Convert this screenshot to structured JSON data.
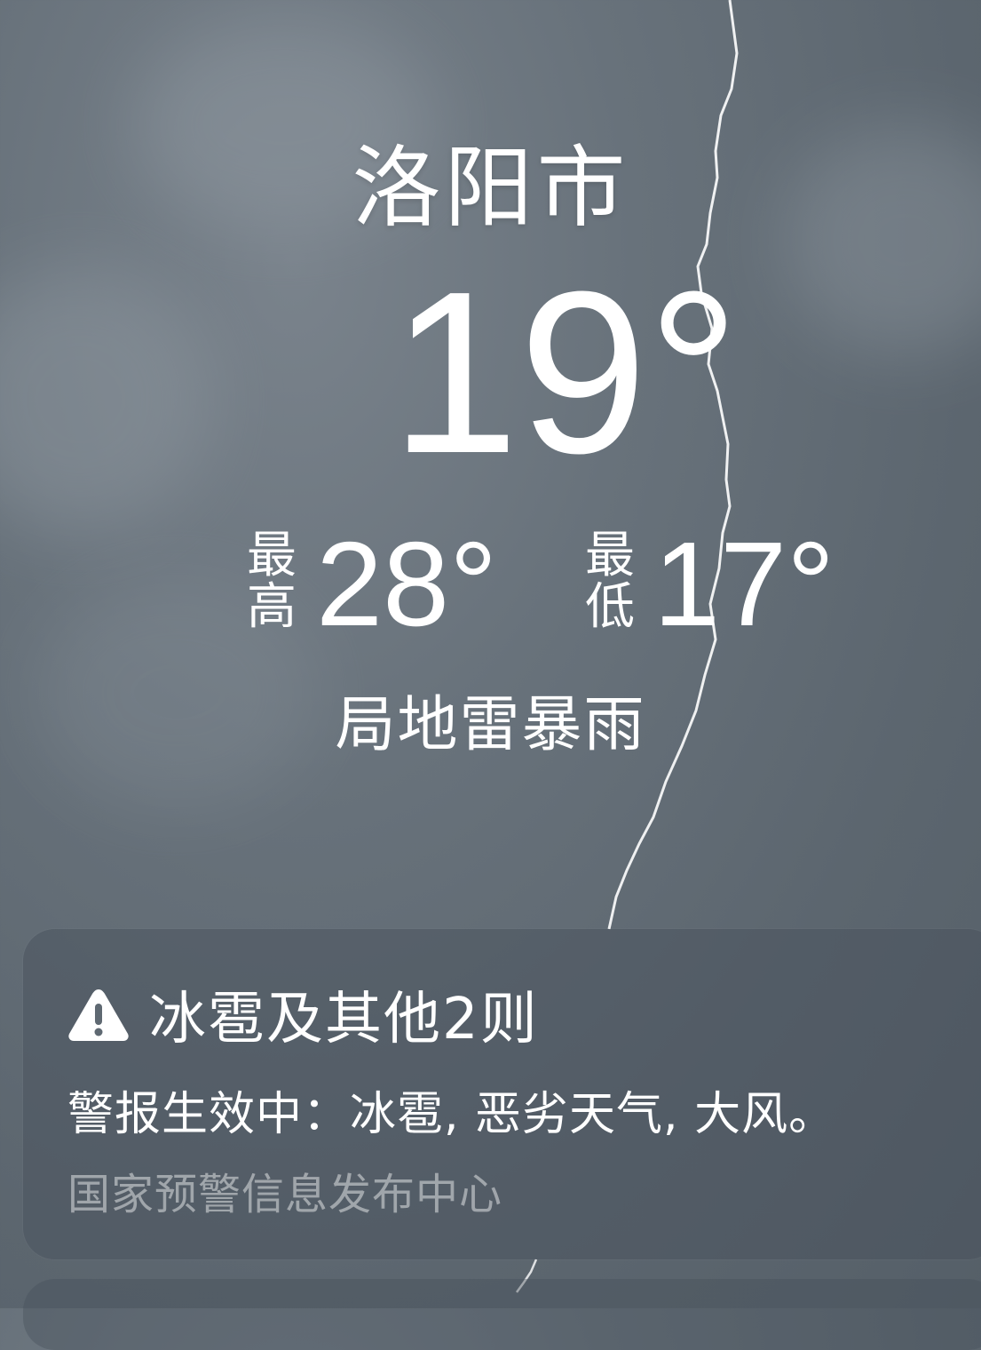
{
  "location": {
    "city": "洛阳市"
  },
  "current": {
    "temperature": "19°"
  },
  "range": {
    "high_label": "最高",
    "high_value": "28°",
    "low_label": "最低",
    "low_value": "17°"
  },
  "condition": "局地雷暴雨",
  "alert": {
    "icon": "warning-triangle-icon",
    "title": "冰雹及其他2则",
    "text": "警报生效中：冰雹, 恶劣天气, 大风。",
    "source": "国家预警信息发布中心"
  }
}
